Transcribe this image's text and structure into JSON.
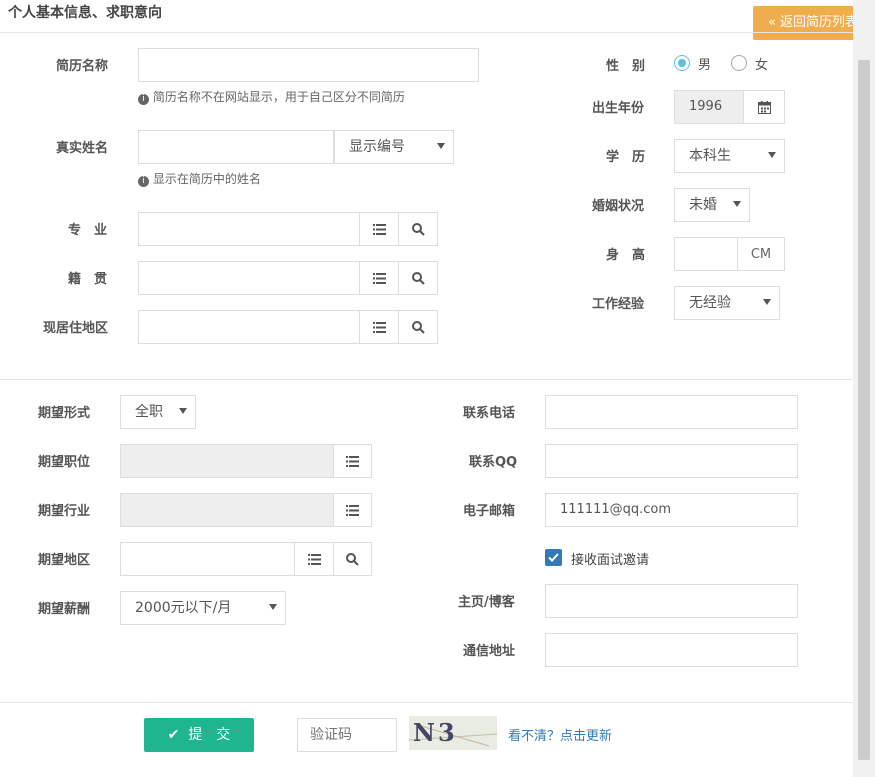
{
  "header": {
    "title": "个人基本信息、求职意向",
    "back_button": "返回简历列表"
  },
  "section1": {
    "resume_name": {
      "label": "简历名称",
      "value": "",
      "help": "简历名称不在网站显示，用于自己区分不同简历"
    },
    "real_name": {
      "label": "真实姓名",
      "value": "",
      "display_option": "显示编号",
      "help": "显示在简历中的姓名"
    },
    "major": {
      "label": "专　业"
    },
    "native_place": {
      "label": "籍　贯"
    },
    "residence": {
      "label": "现居住地区"
    },
    "gender": {
      "label": "性　别",
      "options": [
        "男",
        "女"
      ],
      "selected": "男"
    },
    "birth_year": {
      "label": "出生年份",
      "value": "1996"
    },
    "education": {
      "label": "学　历",
      "value": "本科生"
    },
    "marital": {
      "label": "婚姻状况",
      "value": "未婚"
    },
    "height": {
      "label": "身　高",
      "value": "",
      "unit": "CM"
    },
    "experience": {
      "label": "工作经验",
      "value": "无经验"
    }
  },
  "section2": {
    "job_type": {
      "label": "期望形式",
      "value": "全职"
    },
    "job_position": {
      "label": "期望职位"
    },
    "industry": {
      "label": "期望行业"
    },
    "region": {
      "label": "期望地区"
    },
    "salary": {
      "label": "期望薪酬",
      "value": "2000元以下/月"
    },
    "phone": {
      "label": "联系电话",
      "value": ""
    },
    "qq": {
      "label": "联系QQ",
      "value": ""
    },
    "email": {
      "label": "电子邮箱",
      "value": "111111@qq.com"
    },
    "interview": {
      "label": "接收面试邀请",
      "checked": true
    },
    "homepage": {
      "label": "主页/博客",
      "value": ""
    },
    "address": {
      "label": "通信地址",
      "value": ""
    }
  },
  "footer": {
    "submit": "提　交",
    "captcha_placeholder": "验证码",
    "captcha_text": "N3 dC",
    "refresh": "看不清？点击更新"
  },
  "colors": {
    "accent": "#f0ad4e",
    "submit": "#1fb58f",
    "check": "#337ab7"
  }
}
